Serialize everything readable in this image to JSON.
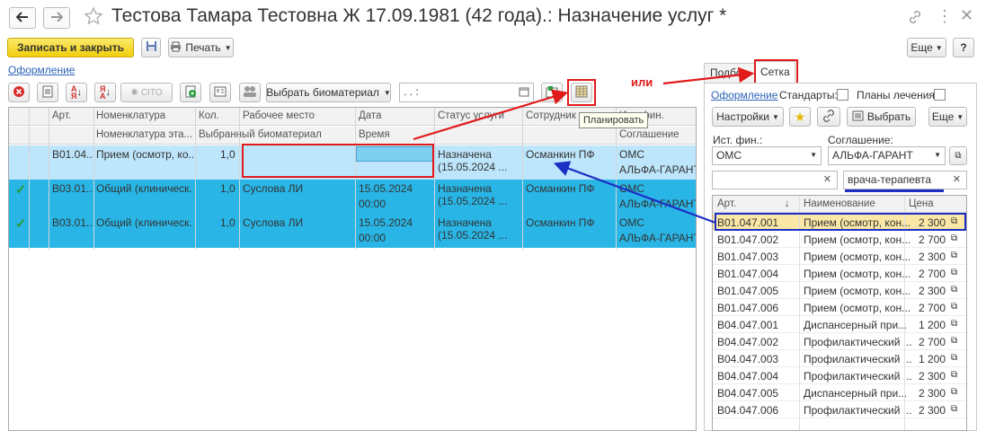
{
  "window": {
    "title": "Тестова Тамара Тестовна Ж 17.09.1981 (42 года).: Назначение услуг *"
  },
  "toolbar": {
    "save_close_label": "Записать и закрыть",
    "print_label": "Печать",
    "more_label": "Еще",
    "help_label": "?"
  },
  "main": {
    "design_link": "Оформление",
    "cito_label": "CITO",
    "select_biomaterial_label": "Выбрать биоматериал",
    "date_value": ".   .        :",
    "tooltip_plan": "Планировать",
    "columns_top": [
      "Арт.",
      "Номенклатура",
      "Кол.",
      "Рабочее место",
      "Дата",
      "Статус услуги",
      "Сотрудник",
      "Ист. фин."
    ],
    "columns_bottom": [
      "Номенклатура эта...",
      "Выбранный биоматериал",
      "Время",
      "Соглашение"
    ],
    "rows": [
      {
        "art": "B01.04...",
        "name": "Прием (осмотр, ко...",
        "qty": "1,0",
        "place": "",
        "date": "",
        "time": "",
        "status1": "Назначена",
        "status2": "(15.05.2024 ...",
        "employee": "Османкин ПФ",
        "fin": "ОМС",
        "agreement": "АЛЬФА-ГАРАНТ",
        "check": false
      },
      {
        "art": "B03.01...",
        "name": "Общий (клиническ...",
        "qty": "1,0",
        "place": "Суслова ЛИ",
        "date": "15.05.2024",
        "time": "00:00",
        "status1": "Назначена",
        "status2": "(15.05.2024 ...",
        "employee": "Османкин ПФ",
        "fin": "ОМС",
        "agreement": "АЛЬФА-ГАРАНТ",
        "check": true
      },
      {
        "art": "B03.01...",
        "name": "Общий (клиническ...",
        "qty": "1,0",
        "place": "Суслова ЛИ",
        "date": "15.05.2024",
        "time": "00:00",
        "status1": "Назначена",
        "status2": "(15.05.2024 ...",
        "employee": "Османкин ПФ",
        "fin": "ОМС",
        "agreement": "АЛЬФА-ГАРАНТ",
        "check": true
      }
    ]
  },
  "annotation": {
    "or_label": "или"
  },
  "right": {
    "tab_select": "Подбор",
    "tab_grid": "Сетка",
    "design_link": "Оформление",
    "standards_label": "Стандарты:",
    "plans_label": "Планы лечения:",
    "settings_label": "Настройки",
    "choose_label": "Выбрать",
    "more_label": "Еще",
    "fin_label": "Ист. фин.:",
    "agreement_label": "Соглашение:",
    "fin_value": "ОМС",
    "agreement_value": "АЛЬФА-ГАРАНТ",
    "search_left_value": "",
    "search_right_value": "врача-терапевта",
    "col_art": "Арт.",
    "col_name": "Наименование",
    "col_price": "Цена",
    "items": [
      {
        "art": "B01.047.001",
        "name": "Прием (осмотр, кон...",
        "price": "2 300"
      },
      {
        "art": "B01.047.002",
        "name": "Прием (осмотр, кон...",
        "price": "2 700"
      },
      {
        "art": "B01.047.003",
        "name": "Прием (осмотр, кон...",
        "price": "2 300"
      },
      {
        "art": "B01.047.004",
        "name": "Прием (осмотр, кон...",
        "price": "2 700"
      },
      {
        "art": "B01.047.005",
        "name": "Прием (осмотр, кон...",
        "price": "2 300"
      },
      {
        "art": "B01.047.006",
        "name": "Прием (осмотр, кон...",
        "price": "2 700"
      },
      {
        "art": "B04.047.001",
        "name": "Диспансерный при...",
        "price": "1 200"
      },
      {
        "art": "B04.047.002",
        "name": "Профилактический ...",
        "price": "2 700"
      },
      {
        "art": "B04.047.003",
        "name": "Профилактический ...",
        "price": "1 200"
      },
      {
        "art": "B04.047.004",
        "name": "Профилактический ...",
        "price": "2 300"
      },
      {
        "art": "B04.047.005",
        "name": "Диспансерный при...",
        "price": "2 300"
      },
      {
        "art": "B04.047.006",
        "name": "Профилактический ...",
        "price": "2 300"
      }
    ]
  },
  "colors": {
    "selected_row": "#bde5fb",
    "marked_row": "#29b6e6",
    "highlight_row": "#fce8a6",
    "annotation_red": "#e01b1b",
    "annotation_blue": "#1d2fc4"
  }
}
